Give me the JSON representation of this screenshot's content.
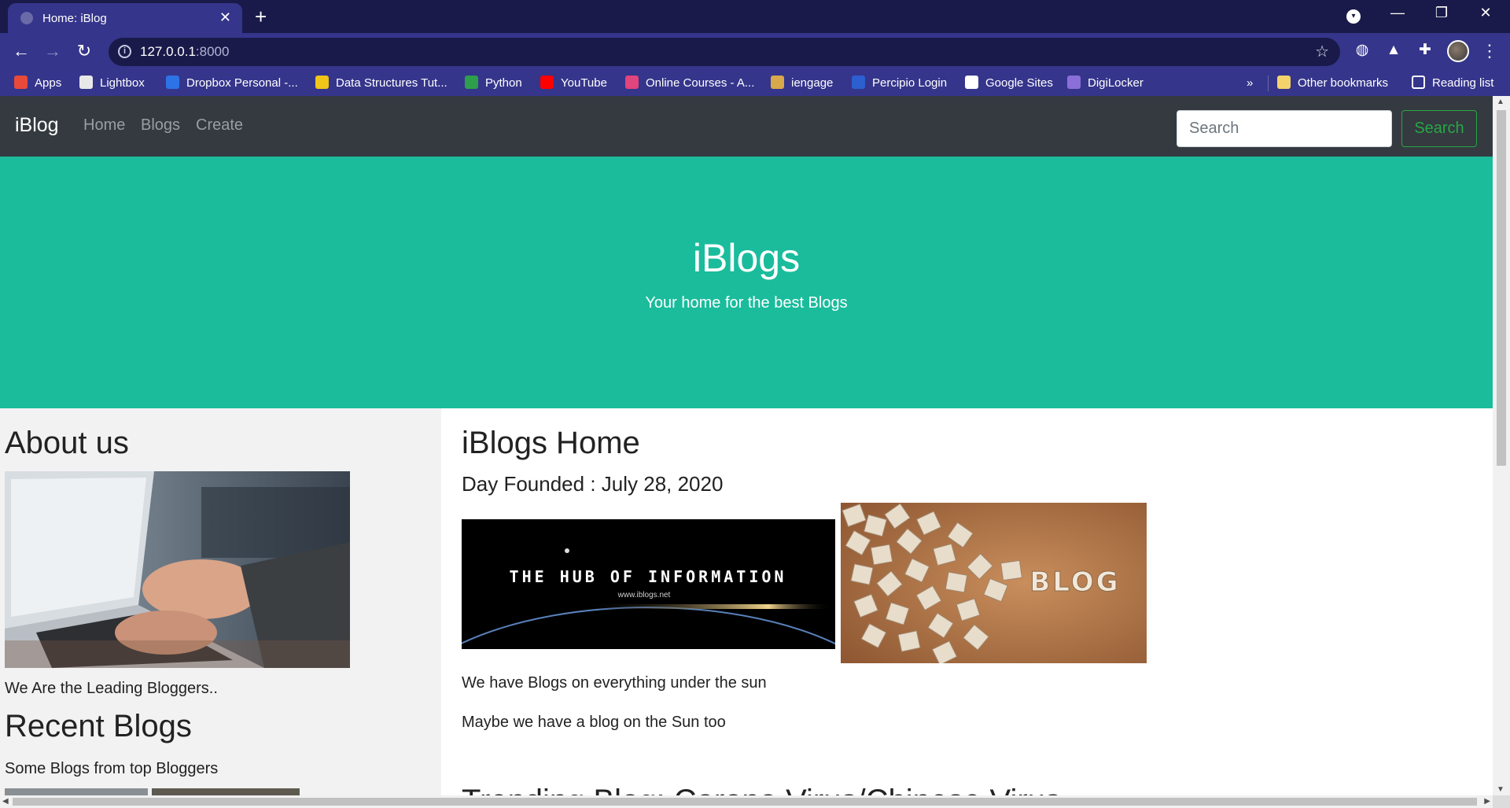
{
  "browser": {
    "tab_title": "Home: iBlog",
    "tab_close": "✕",
    "new_tab": "+",
    "url_host": "127.0.0.1",
    "url_port": ":8000",
    "back": "←",
    "forward": "→",
    "reload": "↻",
    "info": "i",
    "star": "☆",
    "window": {
      "minimize": "—",
      "restore": "❐",
      "close": "✕"
    },
    "bookmarks": [
      {
        "label": "Apps",
        "icon": "apps-grid-icon",
        "color": "#e84a3a"
      },
      {
        "label": "Lightbox",
        "icon": "globe-icon",
        "color": "#e8e8e8"
      },
      {
        "label": "Dropbox Personal -...",
        "icon": "dropbox-icon",
        "color": "#2d73e6"
      },
      {
        "label": "Data Structures Tut...",
        "icon": "gfg-icon",
        "color": "#f0c419"
      },
      {
        "label": "Python",
        "icon": "w3-icon",
        "color": "#2e9e4c"
      },
      {
        "label": "YouTube",
        "icon": "youtube-icon",
        "color": "#ff0000"
      },
      {
        "label": "Online Courses - A...",
        "icon": "udemy-icon",
        "color": "#e0457b"
      },
      {
        "label": "iengage",
        "icon": "iengage-icon",
        "color": "#d9a84a"
      },
      {
        "label": "Percipio Login",
        "icon": "percipio-icon",
        "color": "#2c5fd0"
      },
      {
        "label": "Google Sites",
        "icon": "google-sites-icon",
        "color": "#ffffff"
      },
      {
        "label": "DigiLocker",
        "icon": "cloud-icon",
        "color": "#8b6fd8"
      }
    ],
    "more_bookmarks": "»",
    "other_bookmarks": "Other bookmarks",
    "reading_list": "Reading list"
  },
  "site": {
    "brand": "iBlog",
    "nav": [
      "Home",
      "Blogs",
      "Create"
    ],
    "search_placeholder": "Search",
    "search_button": "Search",
    "hero": {
      "title": "iBlogs",
      "subtitle": "Your home for the best Blogs"
    },
    "sidebar": {
      "about_heading": "About us",
      "about_caption": "We Are the Leading Bloggers..",
      "recent_heading": "Recent Blogs",
      "recent_subtitle": "Some Blogs from top Bloggers"
    },
    "main": {
      "heading": "iBlogs Home",
      "founded": "Day Founded : July 28, 2020",
      "hub_text": "THE HUB OF INFORMATION",
      "hub_url": "www.iblogs.net",
      "blog_word": "BLOG",
      "para1": "We have Blogs on everything under the sun",
      "para2": "Maybe we have a blog on the Sun too",
      "trending": "Trending Blog: Corona Virus/Chinese Virus"
    }
  },
  "colors": {
    "tabstrip": "#1a1a4a",
    "toolbar": "#35358c",
    "navbar": "#343a40",
    "hero": "#1abc9c",
    "search_green": "#28a745"
  }
}
